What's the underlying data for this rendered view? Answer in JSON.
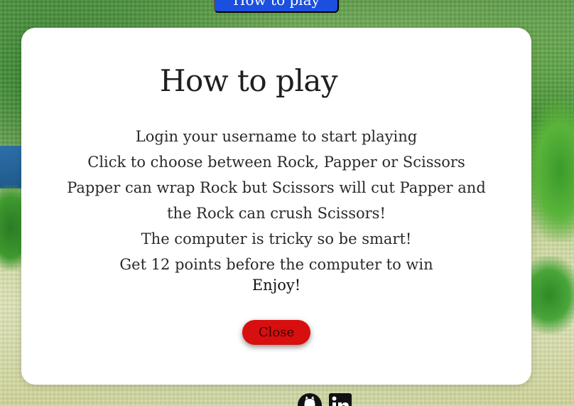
{
  "header": {
    "play_button_label": "How to play"
  },
  "modal": {
    "title": "How to play",
    "instructions": [
      "Login your username to start playing",
      "Click to choose between Rock, Papper or Scissors",
      "Papper can wrap Rock but Scissors will cut Papper and the Rock can crush Scissors!",
      "The computer is tricky so be smart!",
      "Get 12 points before the computer to win"
    ],
    "enjoy": "Enjoy!",
    "close_label": "Close"
  },
  "footer": {
    "icons": [
      "github-icon",
      "linkedin-icon"
    ]
  },
  "colors": {
    "close_button": "#d80f0f",
    "top_button": "#1a4fe0",
    "modal_background": "#ffffff"
  }
}
